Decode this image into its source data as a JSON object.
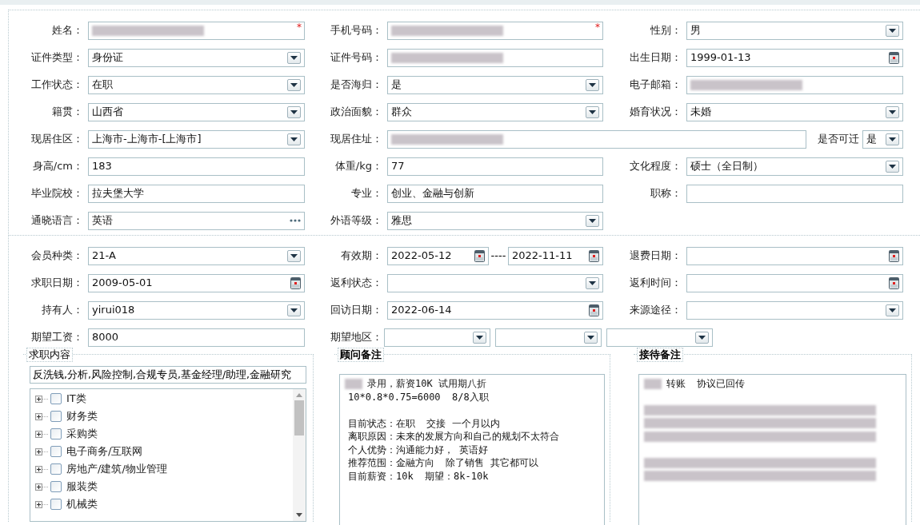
{
  "personal_fields": [
    {
      "label": "姓名：",
      "kind": "text",
      "redacted": true,
      "required_mark": "*"
    },
    {
      "label": "手机号码：",
      "kind": "text",
      "redacted": true,
      "required_mark": "*"
    },
    {
      "label": "性别：",
      "kind": "select",
      "value": "男"
    },
    {
      "label": "证件类型：",
      "kind": "select",
      "value": "身份证"
    },
    {
      "label": "证件号码：",
      "kind": "text",
      "redacted": true
    },
    {
      "label": "出生日期：",
      "kind": "date",
      "value": "1999-01-13"
    },
    {
      "label": "工作状态：",
      "kind": "select",
      "value": "在职"
    },
    {
      "label": "是否海归：",
      "kind": "select",
      "value": "是"
    },
    {
      "label": "电子邮箱：",
      "kind": "text",
      "redacted": true
    },
    {
      "label": "籍贯：",
      "kind": "select",
      "value": "山西省"
    },
    {
      "label": "政治面貌：",
      "kind": "select",
      "value": "群众"
    },
    {
      "label": "婚育状况：",
      "kind": "select",
      "value": "未婚"
    },
    {
      "label": "现居住区：",
      "kind": "select",
      "value": "上海市-上海市-[上海市]"
    },
    {
      "label": "现居住址：",
      "kind": "address",
      "redacted": true,
      "relocate": {
        "label": "是否可迁",
        "value": "是"
      }
    },
    {
      "label": "身高/cm：",
      "kind": "text",
      "value": "183"
    },
    {
      "label": "体重/kg：",
      "kind": "text",
      "value": "77"
    },
    {
      "label": "文化程度：",
      "kind": "select",
      "value": "硕士（全日制）"
    },
    {
      "label": "毕业院校：",
      "kind": "text",
      "value": "拉夫堡大学"
    },
    {
      "label": "专业：",
      "kind": "text",
      "value": "创业、金融与创新"
    },
    {
      "label": "职称：",
      "kind": "text"
    },
    {
      "label": "通晓语言：",
      "kind": "lookup",
      "value": "英语"
    },
    {
      "label": "外语等级：",
      "kind": "select",
      "value": "雅思"
    }
  ],
  "member_fields": [
    {
      "label": "会员种类：",
      "kind": "select",
      "value": "21-A"
    },
    {
      "label": "有效期：",
      "kind": "date_range",
      "from": "2022-05-12",
      "separator": "----",
      "to": "2022-11-11"
    },
    {
      "label": "退费日期：",
      "kind": "date"
    },
    {
      "label": "求职日期：",
      "kind": "date",
      "value": "2009-05-01"
    },
    {
      "label": "返利状态：",
      "kind": "select"
    },
    {
      "label": "返利时间：",
      "kind": "date"
    },
    {
      "label": "持有人：",
      "kind": "select",
      "value": "yirui018"
    },
    {
      "label": "回访日期：",
      "kind": "date",
      "value": "2022-06-14"
    },
    {
      "label": "来源途径：",
      "kind": "select"
    },
    {
      "label": "期望工资：",
      "kind": "text",
      "value": "8000"
    },
    {
      "label": "期望地区：",
      "kind": "region",
      "selects": [
        {
          "kind": "select"
        },
        {
          "kind": "select"
        },
        {
          "kind": "select"
        }
      ]
    }
  ],
  "panels": [
    {
      "title": "求职内容",
      "kind": "tree",
      "summary": "反洗钱,分析,风险控制,合规专员,基金经理/助理,金融研究",
      "items": [
        {
          "label": "IT类",
          "checked": false,
          "expanded": false
        },
        {
          "label": "财务类",
          "checked": false,
          "expanded": false
        },
        {
          "label": "采购类",
          "checked": false,
          "expanded": false
        },
        {
          "label": "电子商务/互联网",
          "checked": false,
          "expanded": false
        },
        {
          "label": "房地产/建筑/物业管理",
          "checked": false,
          "expanded": false
        },
        {
          "label": "服装类",
          "checked": false,
          "expanded": false
        },
        {
          "label": "机械类",
          "checked": false,
          "expanded": false
        }
      ]
    },
    {
      "title": "顾问备注",
      "kind": "notes",
      "paragraphs": [
        [
          {
            "redacted": true,
            "text": "录用，薪资10K 试用期八折"
          },
          {
            "redacted": false,
            "text": "10*0.8*0.75=6000  8/8入职"
          }
        ],
        [
          {
            "redacted": false,
            "text": "目前状态：在职  交接 一个月以内"
          },
          {
            "redacted": false,
            "text": "离职原因：未来的发展方向和自己的规划不太符合"
          },
          {
            "redacted": false,
            "text": "个人优势：沟通能力好， 英语好"
          },
          {
            "redacted": false,
            "text": "推荐范围：金融方向  除了销售 其它都可以"
          },
          {
            "redacted": false,
            "text": "目前薪资：10k  期望：8k-10k"
          }
        ]
      ]
    },
    {
      "title": "接待备注",
      "kind": "notes",
      "paragraphs": [
        [
          {
            "redacted": true,
            "text": "转账  协议已回传"
          }
        ],
        [
          {
            "redacted": true
          },
          {
            "redacted": true
          },
          {
            "redacted": true
          }
        ],
        [
          {
            "redacted": true
          },
          {
            "redacted": true
          }
        ]
      ]
    }
  ]
}
